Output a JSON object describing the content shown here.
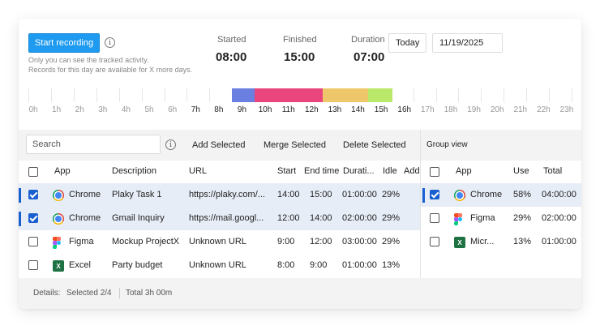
{
  "header": {
    "record_label": "Start recording",
    "note_line1": "Only you can see the tracked activity.",
    "note_line2": "Records for this day are available for X more days.",
    "started_label": "Started",
    "started_value": "08:00",
    "finished_label": "Finished",
    "finished_value": "15:00",
    "duration_label": "Duration",
    "duration_value": "07:00",
    "today_label": "Today",
    "date_value": "11/19/2025"
  },
  "timeline": {
    "hours": [
      "0h",
      "1h",
      "2h",
      "3h",
      "4h",
      "5h",
      "6h",
      "7h",
      "8h",
      "9h",
      "10h",
      "11h",
      "12h",
      "13h",
      "14h",
      "15h",
      "16h",
      "17h",
      "18h",
      "19h",
      "20h",
      "21h",
      "22h",
      "23h"
    ],
    "active_hours": [
      "7h",
      "8h",
      "9h",
      "10h",
      "11h",
      "12h",
      "13h",
      "14h",
      "15h",
      "16h"
    ],
    "segments": [
      {
        "start_hour": 9.0,
        "end_hour": 10.0,
        "color": "#6b7fe0"
      },
      {
        "start_hour": 10.0,
        "end_hour": 13.0,
        "color": "#e8467c"
      },
      {
        "start_hour": 13.0,
        "end_hour": 15.0,
        "color": "#eec76a"
      },
      {
        "start_hour": 15.0,
        "end_hour": 16.1,
        "color": "#b9e86a"
      }
    ]
  },
  "toolbar": {
    "search_placeholder": "Search",
    "add_selected": "Add Selected",
    "merge_selected": "Merge Selected",
    "delete_selected": "Delete Selected",
    "group_view": "Group view"
  },
  "main_table": {
    "columns": [
      "App",
      "Description",
      "URL",
      "Start",
      "End time",
      "Durati...",
      "Idle",
      "Add"
    ],
    "rows": [
      {
        "selected": true,
        "app": "Chrome",
        "icon": "chrome-icon",
        "description": "Plaky Task 1",
        "url": "https://plaky.com/...",
        "start": "14:00",
        "end": "15:00",
        "duration": "01:00:00",
        "idle": "29%"
      },
      {
        "selected": true,
        "app": "Chrome",
        "icon": "chrome-icon",
        "description": "Gmail Inquiry",
        "url": "https://mail.googl...",
        "start": "12:00",
        "end": "14:00",
        "duration": "02:00:00",
        "idle": "29%"
      },
      {
        "selected": false,
        "app": "Figma",
        "icon": "figma-icon",
        "description": "Mockup ProjectX",
        "url": "Unknown URL",
        "start": "9:00",
        "end": "12:00",
        "duration": "03:00:00",
        "idle": "29%"
      },
      {
        "selected": false,
        "app": "Excel",
        "icon": "excel-icon",
        "description": "Party budget",
        "url": "Unknown URL",
        "start": "8:00",
        "end": "9:00",
        "duration": "01:00:00",
        "idle": "13%"
      }
    ]
  },
  "group_table": {
    "columns": [
      "App",
      "Use",
      "Total"
    ],
    "rows": [
      {
        "selected": true,
        "app": "Chrome",
        "icon": "chrome-icon",
        "use": "58%",
        "total": "04:00:00"
      },
      {
        "selected": false,
        "app": "Figma",
        "icon": "figma-icon",
        "use": "29%",
        "total": "02:00:00"
      },
      {
        "selected": false,
        "app": "Micr...",
        "icon": "excel-icon",
        "use": "13%",
        "total": "01:00:00"
      }
    ]
  },
  "footer": {
    "details": "Details:",
    "selected": "Selected 2/4",
    "total": "Total 3h 00m"
  },
  "colors": {
    "accent": "#1e9bf0",
    "selected_row": "#e7edf6",
    "checkbox": "#1a5fd0"
  }
}
